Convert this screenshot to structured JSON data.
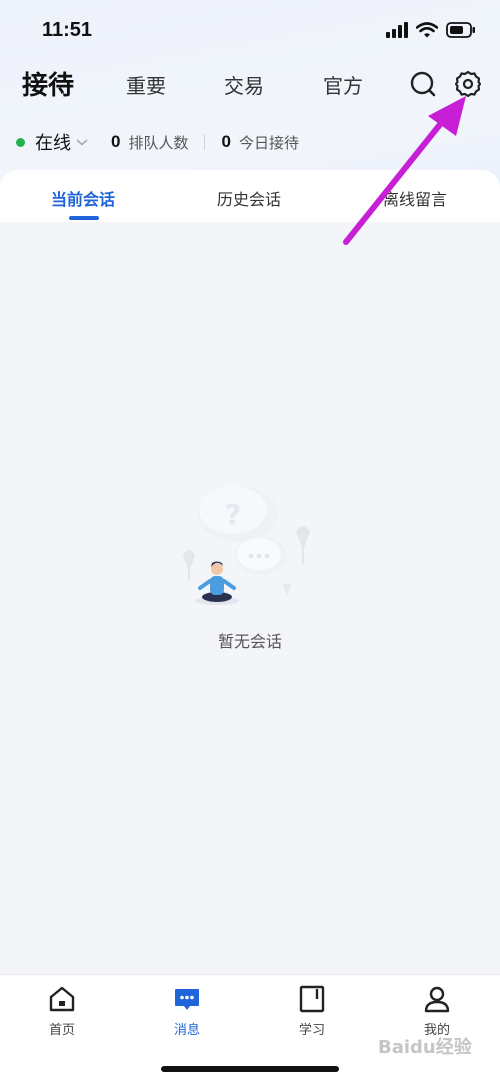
{
  "status_bar": {
    "time": "11:51"
  },
  "top_nav": {
    "tabs": [
      {
        "label": "接待",
        "active": true
      },
      {
        "label": "重要"
      },
      {
        "label": "交易"
      },
      {
        "label": "官方"
      }
    ],
    "icons": [
      "search-icon",
      "settings-gear-icon"
    ]
  },
  "online_status": {
    "label": "在线",
    "dot_color": "#22b14c",
    "queue_count": "0",
    "queue_label": "排队人数",
    "today_count": "0",
    "today_label": "今日接待"
  },
  "conversation_tabs": [
    {
      "label": "当前会话",
      "active": true
    },
    {
      "label": "历史会话"
    },
    {
      "label": "离线留言"
    }
  ],
  "empty_state": {
    "text": "暂无会话"
  },
  "bottom_nav": [
    {
      "label": "首页",
      "icon": "home-icon"
    },
    {
      "label": "消息",
      "icon": "message-icon",
      "active": true
    },
    {
      "label": "学习",
      "icon": "book-icon"
    },
    {
      "label": "我的",
      "icon": "person-icon"
    }
  ],
  "colors": {
    "accent": "#1f64d8",
    "annotation_arrow": "#c71fd6"
  },
  "watermark": "Baidu经验"
}
